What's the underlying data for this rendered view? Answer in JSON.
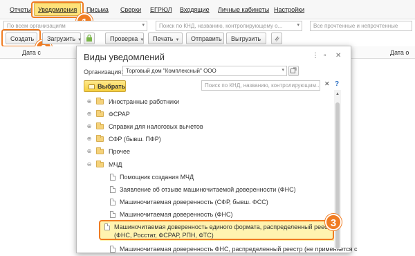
{
  "menu": {
    "items": [
      "Отчеты",
      "Уведомления",
      "Письма",
      "Сверки",
      "ЕГРЮЛ",
      "Входящие",
      "Личные кабинеты",
      "Настройки"
    ],
    "active_index": 1
  },
  "filters": {
    "organization_placeholder": "По всем организациям",
    "search_placeholder": "Поиск по КНД, названию, контролирующему о...",
    "status_placeholder": "Все прочтенные и непрочтенные"
  },
  "toolbar": {
    "create": "Создать",
    "upload": "Загрузить",
    "check": "Проверка",
    "print": "Печать",
    "send": "Отправить",
    "unload": "Выгрузить"
  },
  "list": {
    "col_date_left": "Дата с",
    "col_date_right": "Дата о"
  },
  "steps": [
    "1",
    "2",
    "3"
  ],
  "accent_color": "#f07c22",
  "highlight_color": "#fff3b0",
  "modal": {
    "title": "Виды уведомлений",
    "org_label": "Организация:",
    "org_value": "Торговый дом \"Комплексный\" ООО",
    "select_button": "Выбрать",
    "search_placeholder": "Поиск по КНД, названию, контролирующим...",
    "help": "?",
    "tree": [
      {
        "type": "folder",
        "label": "Иностранные работники"
      },
      {
        "type": "folder",
        "label": "ФСРАР"
      },
      {
        "type": "folder",
        "label": "Справки для налоговых вычетов"
      },
      {
        "type": "folder",
        "label": "СФР (бывш. ПФР)"
      },
      {
        "type": "folder",
        "label": "Прочее"
      },
      {
        "type": "folder-open",
        "label": "МЧД"
      },
      {
        "type": "doc",
        "label": "Помощник создания МЧД"
      },
      {
        "type": "doc",
        "label": "Заявление об отзыве машиночитаемой доверенности (ФНС)"
      },
      {
        "type": "doc",
        "label": "Машиночитаемая доверенность (СФР, бывш. ФСС)"
      },
      {
        "type": "doc",
        "label": "Машиночитаемая доверенность (ФНС)"
      },
      {
        "type": "doc",
        "label": "Машиночитаемая доверенность единого формата, распределенный реестр",
        "label2": "(ФНС, Росстат, ФСРАР, РПН, ФТС)",
        "highlight": true
      },
      {
        "type": "doc",
        "label": "Машиночитаемая доверенность ФНС, распределенный реестр (не применяется с"
      }
    ]
  }
}
